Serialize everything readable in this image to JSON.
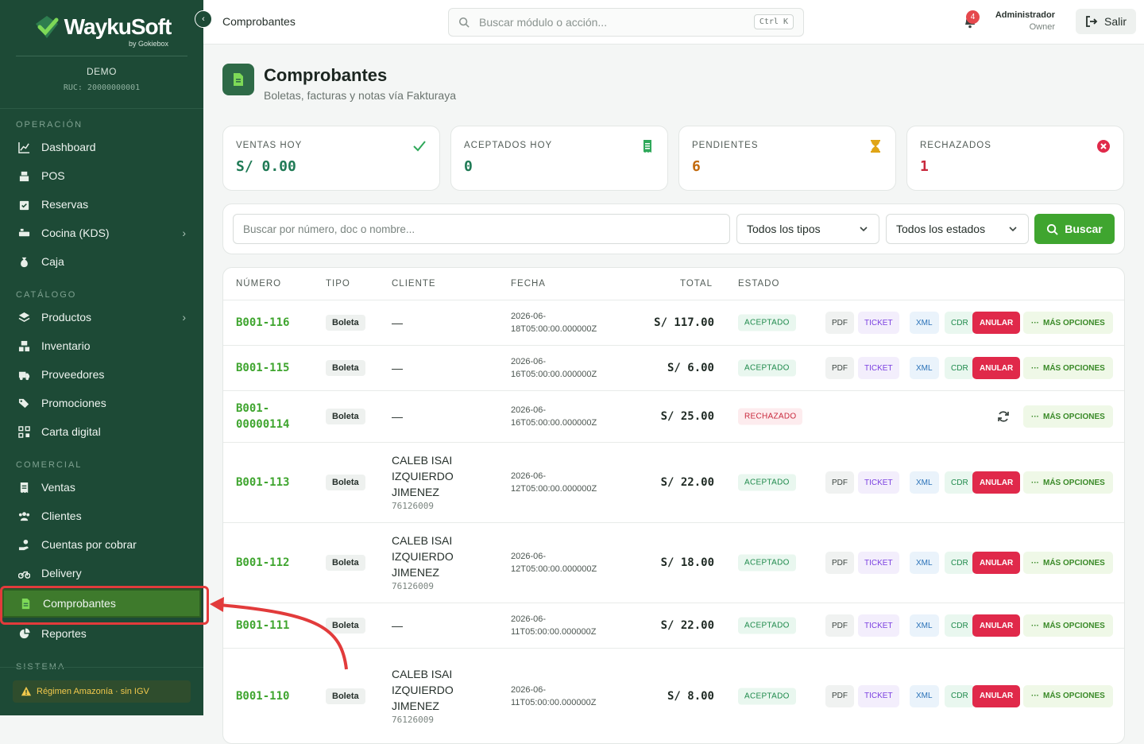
{
  "brand": {
    "name": "WaykuSoft",
    "byline": "by Gokiebox",
    "company": "DEMO",
    "ruc": "RUC: 20000000001"
  },
  "sidebar": {
    "sections": [
      {
        "title": "OPERACIÓN",
        "items": [
          {
            "label": "Dashboard",
            "icon": "chart-line-icon"
          },
          {
            "label": "POS",
            "icon": "cash-register-icon"
          },
          {
            "label": "Reservas",
            "icon": "calendar-check-icon"
          },
          {
            "label": "Cocina (KDS)",
            "icon": "kitchen-icon",
            "chevron": true
          },
          {
            "label": "Caja",
            "icon": "cash-bag-icon"
          }
        ]
      },
      {
        "title": "CATÁLOGO",
        "items": [
          {
            "label": "Productos",
            "icon": "layers-icon",
            "chevron": true
          },
          {
            "label": "Inventario",
            "icon": "boxes-icon"
          },
          {
            "label": "Proveedores",
            "icon": "truck-icon"
          },
          {
            "label": "Promociones",
            "icon": "tags-icon"
          },
          {
            "label": "Carta digital",
            "icon": "qr-code-icon"
          }
        ]
      },
      {
        "title": "COMERCIAL",
        "items": [
          {
            "label": "Ventas",
            "icon": "receipt-icon"
          },
          {
            "label": "Clientes",
            "icon": "users-icon"
          },
          {
            "label": "Cuentas por cobrar",
            "icon": "hand-coin-icon"
          },
          {
            "label": "Delivery",
            "icon": "motorcycle-icon"
          },
          {
            "label": "Comprobantes",
            "icon": "file-invoice-icon",
            "active": true
          },
          {
            "label": "Reportes",
            "icon": "pie-chart-icon"
          }
        ]
      },
      {
        "title": "SISTEMA",
        "items": []
      }
    ],
    "regimen": "Régimen Amazonía · sin IGV"
  },
  "topbar": {
    "breadcrumb": "Comprobantes",
    "search_placeholder": "Buscar módulo o acción...",
    "shortcut": "Ctrl K",
    "notifications": "4",
    "user_name": "Administrador",
    "user_role": "Owner",
    "logout": "Salir"
  },
  "page": {
    "title": "Comprobantes",
    "subtitle": "Boletas, facturas y notas vía Fakturaya"
  },
  "stats": [
    {
      "label": "VENTAS HOY",
      "value": "S/ 0.00",
      "color": "#1f7a55",
      "icon": "check-icon"
    },
    {
      "label": "ACEPTADOS HOY",
      "value": "0",
      "color": "#1f7a55",
      "icon": "receipt-icon"
    },
    {
      "label": "PENDIENTES",
      "value": "6",
      "color": "#c26a0e",
      "icon": "hourglass-icon"
    },
    {
      "label": "RECHAZADOS",
      "value": "1",
      "color": "#c8283c",
      "icon": "x-circle-icon"
    }
  ],
  "filters": {
    "search_placeholder": "Buscar por número, doc o nombre...",
    "type_select": "Todos los tipos",
    "status_select": "Todos los estados",
    "search_button": "Buscar"
  },
  "table": {
    "headers": [
      "NÚMERO",
      "TIPO",
      "CLIENTE",
      "FECHA",
      "TOTAL",
      "ESTADO"
    ],
    "actions": {
      "pdf": "PDF",
      "ticket": "TICKET",
      "xml": "XML",
      "cdr": "CDR",
      "anular": "ANULAR",
      "more": "MÁS OPCIONES"
    },
    "rows": [
      {
        "numero": [
          "B001-116"
        ],
        "tipo": "Boleta",
        "cliente": [
          "—"
        ],
        "doc": "",
        "fecha": [
          "2026-06-",
          "18T05:00:00.000000Z"
        ],
        "total": "S/ 117.00",
        "estado": "ACEPTADO",
        "ok": true
      },
      {
        "numero": [
          "B001-115"
        ],
        "tipo": "Boleta",
        "cliente": [
          "—"
        ],
        "doc": "",
        "fecha": [
          "2026-06-",
          "16T05:00:00.000000Z"
        ],
        "total": "S/ 6.00",
        "estado": "ACEPTADO",
        "ok": true
      },
      {
        "numero": [
          "B001-",
          "00000114"
        ],
        "tipo": "Boleta",
        "cliente": [
          "—"
        ],
        "doc": "",
        "fecha": [
          "2026-06-",
          "16T05:00:00.000000Z"
        ],
        "total": "S/ 25.00",
        "estado": "RECHAZADO",
        "ok": false
      },
      {
        "numero": [
          "B001-113"
        ],
        "tipo": "Boleta",
        "cliente": [
          "CALEB ISAI",
          "IZQUIERDO",
          "JIMENEZ"
        ],
        "doc": "76126009",
        "fecha": [
          "2026-06-",
          "12T05:00:00.000000Z"
        ],
        "total": "S/ 22.00",
        "estado": "ACEPTADO",
        "ok": true
      },
      {
        "numero": [
          "B001-112"
        ],
        "tipo": "Boleta",
        "cliente": [
          "CALEB ISAI",
          "IZQUIERDO",
          "JIMENEZ"
        ],
        "doc": "76126009",
        "fecha": [
          "2026-06-",
          "12T05:00:00.000000Z"
        ],
        "total": "S/ 18.00",
        "estado": "ACEPTADO",
        "ok": true
      },
      {
        "numero": [
          "B001-111"
        ],
        "tipo": "Boleta",
        "cliente": [
          "—"
        ],
        "doc": "",
        "fecha": [
          "2026-06-",
          "11T05:00:00.000000Z"
        ],
        "total": "S/ 22.00",
        "estado": "ACEPTADO",
        "ok": true
      },
      {
        "numero": [
          "B001-110"
        ],
        "tipo": "Boleta",
        "cliente": [
          "CALEB ISAI",
          "IZQUIERDO",
          "JIMENEZ"
        ],
        "doc": "76126009",
        "fecha": [
          "2026-06-",
          "11T05:00:00.000000Z"
        ],
        "total": "S/ 8.00",
        "estado": "ACEPTADO",
        "ok": true
      }
    ]
  },
  "colors": {
    "sidebar": "#1d4a36",
    "accent": "#3fa52f",
    "danger": "#e0294a",
    "annotation": "#e23b3b"
  }
}
